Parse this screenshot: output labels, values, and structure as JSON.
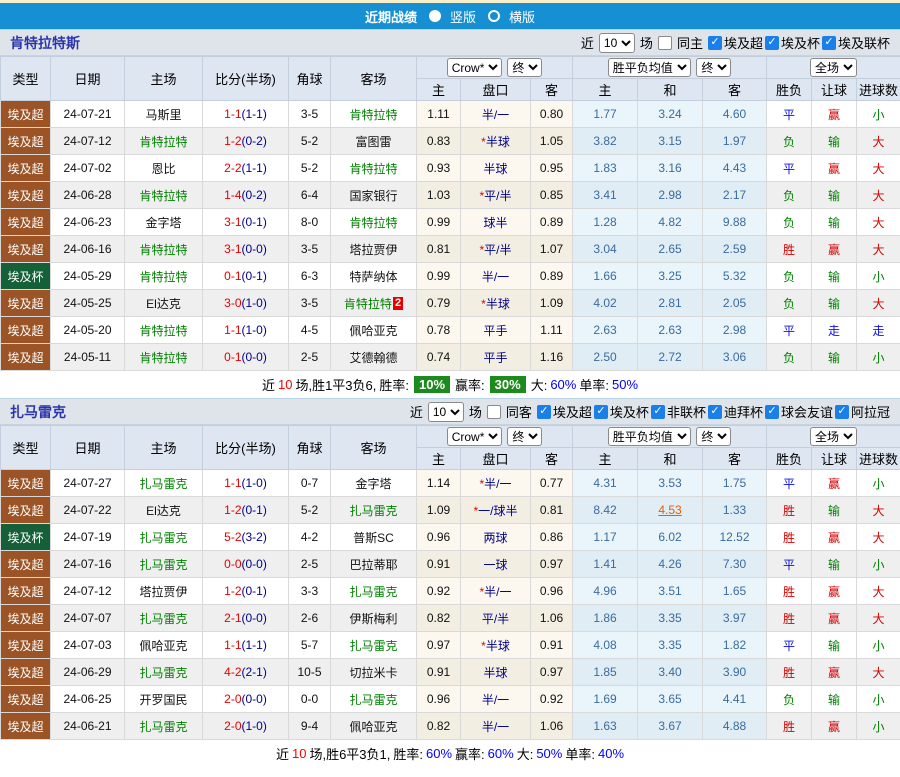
{
  "title_bar": {
    "title": "近期战绩",
    "options": [
      {
        "label": "竖版",
        "selected": true
      },
      {
        "label": "横版",
        "selected": false
      }
    ]
  },
  "columns": {
    "type": "类型",
    "date": "日期",
    "home": "主场",
    "score": "比分(半场)",
    "corner": "角球",
    "away": "客场",
    "odds_home": "主",
    "handicap": "盘口",
    "odds_away": "客",
    "avg_home": "主",
    "avg_draw": "和",
    "avg_away": "客",
    "result_wdl": "胜负",
    "result_handicap": "让球",
    "result_goals": "进球数"
  },
  "dropdowns": {
    "company": "Crow*",
    "final": "终",
    "avg": "胜平负均值",
    "scope": "全场"
  },
  "sections": [
    {
      "team": "肯特拉特斯",
      "filter": {
        "near_label": "近",
        "match_count": "10",
        "matches_label": "场",
        "same_venue_label": "同主",
        "same_venue_checked": false,
        "leagues": [
          {
            "label": "埃及超",
            "checked": true
          },
          {
            "label": "埃及杯",
            "checked": true
          },
          {
            "label": "埃及联杯",
            "checked": true
          }
        ]
      },
      "rows": [
        {
          "league": "埃及超",
          "league_type": "super",
          "date": "24-07-21",
          "home": "马斯里",
          "home_subject": false,
          "score": "1-1",
          "half": "(1-1)",
          "corner": "3-5",
          "away": "肯特拉特",
          "away_subject": true,
          "away_badge": "",
          "odds_home": "1.11",
          "handicap_star": false,
          "handicap": "半/一",
          "odds_away": "0.80",
          "avg_home": "1.77",
          "avg_draw": "3.24",
          "avg_away": "4.60",
          "avg_draw_link": false,
          "wdl": "平",
          "handicap_result": "赢",
          "goals": "小"
        },
        {
          "league": "埃及超",
          "league_type": "super",
          "date": "24-07-12",
          "home": "肯特拉特",
          "home_subject": true,
          "score": "1-2",
          "half": "(0-2)",
          "corner": "5-2",
          "away": "富图雷",
          "away_subject": false,
          "away_badge": "",
          "odds_home": "0.83",
          "handicap_star": true,
          "handicap": "半球",
          "odds_away": "1.05",
          "avg_home": "3.82",
          "avg_draw": "3.15",
          "avg_away": "1.97",
          "avg_draw_link": false,
          "wdl": "负",
          "handicap_result": "输",
          "goals": "大"
        },
        {
          "league": "埃及超",
          "league_type": "super",
          "date": "24-07-02",
          "home": "恩比",
          "home_subject": false,
          "score": "2-2",
          "half": "(1-1)",
          "corner": "5-2",
          "away": "肯特拉特",
          "away_subject": true,
          "away_badge": "",
          "odds_home": "0.93",
          "handicap_star": false,
          "handicap": "半球",
          "odds_away": "0.95",
          "avg_home": "1.83",
          "avg_draw": "3.16",
          "avg_away": "4.43",
          "avg_draw_link": false,
          "wdl": "平",
          "handicap_result": "赢",
          "goals": "大"
        },
        {
          "league": "埃及超",
          "league_type": "super",
          "date": "24-06-28",
          "home": "肯特拉特",
          "home_subject": true,
          "score": "1-4",
          "half": "(0-2)",
          "corner": "6-4",
          "away": "国家银行",
          "away_subject": false,
          "away_badge": "",
          "odds_home": "1.03",
          "handicap_star": true,
          "handicap": "平/半",
          "odds_away": "0.85",
          "avg_home": "3.41",
          "avg_draw": "2.98",
          "avg_away": "2.17",
          "avg_draw_link": false,
          "wdl": "负",
          "handicap_result": "输",
          "goals": "大"
        },
        {
          "league": "埃及超",
          "league_type": "super",
          "date": "24-06-23",
          "home": "金字塔",
          "home_subject": false,
          "score": "3-1",
          "half": "(0-1)",
          "corner": "8-0",
          "away": "肯特拉特",
          "away_subject": true,
          "away_badge": "",
          "odds_home": "0.99",
          "handicap_star": false,
          "handicap": "球半",
          "odds_away": "0.89",
          "avg_home": "1.28",
          "avg_draw": "4.82",
          "avg_away": "9.88",
          "avg_draw_link": false,
          "wdl": "负",
          "handicap_result": "输",
          "goals": "大"
        },
        {
          "league": "埃及超",
          "league_type": "super",
          "date": "24-06-16",
          "home": "肯特拉特",
          "home_subject": true,
          "score": "3-1",
          "half": "(0-0)",
          "corner": "3-5",
          "away": "塔拉贾伊",
          "away_subject": false,
          "away_badge": "",
          "odds_home": "0.81",
          "handicap_star": true,
          "handicap": "平/半",
          "odds_away": "1.07",
          "avg_home": "3.04",
          "avg_draw": "2.65",
          "avg_away": "2.59",
          "avg_draw_link": false,
          "wdl": "胜",
          "handicap_result": "赢",
          "goals": "大"
        },
        {
          "league": "埃及杯",
          "league_type": "cup",
          "date": "24-05-29",
          "home": "肯特拉特",
          "home_subject": true,
          "score": "0-1",
          "half": "(0-1)",
          "corner": "6-3",
          "away": "特萨纳体",
          "away_subject": false,
          "away_badge": "",
          "odds_home": "0.99",
          "handicap_star": false,
          "handicap": "半/一",
          "odds_away": "0.89",
          "avg_home": "1.66",
          "avg_draw": "3.25",
          "avg_away": "5.32",
          "avg_draw_link": false,
          "wdl": "负",
          "handicap_result": "输",
          "goals": "小"
        },
        {
          "league": "埃及超",
          "league_type": "super",
          "date": "24-05-25",
          "home": "El达克",
          "home_subject": false,
          "score": "3-0",
          "half": "(1-0)",
          "corner": "3-5",
          "away": "肯特拉特",
          "away_subject": true,
          "away_badge": "2",
          "odds_home": "0.79",
          "handicap_star": true,
          "handicap": "半球",
          "odds_away": "1.09",
          "avg_home": "4.02",
          "avg_draw": "2.81",
          "avg_away": "2.05",
          "avg_draw_link": false,
          "wdl": "负",
          "handicap_result": "输",
          "goals": "大"
        },
        {
          "league": "埃及超",
          "league_type": "super",
          "date": "24-05-20",
          "home": "肯特拉特",
          "home_subject": true,
          "score": "1-1",
          "half": "(1-0)",
          "corner": "4-5",
          "away": "佩哈亚克",
          "away_subject": false,
          "away_badge": "",
          "odds_home": "0.78",
          "handicap_star": false,
          "handicap": "平手",
          "odds_away": "1.11",
          "avg_home": "2.63",
          "avg_draw": "2.63",
          "avg_away": "2.98",
          "avg_draw_link": false,
          "wdl": "平",
          "handicap_result": "走",
          "goals": "走"
        },
        {
          "league": "埃及超",
          "league_type": "super",
          "date": "24-05-11",
          "home": "肯特拉特",
          "home_subject": true,
          "score": "0-1",
          "half": "(0-0)",
          "corner": "2-5",
          "away": "艾德翰德",
          "away_subject": false,
          "away_badge": "",
          "odds_home": "0.74",
          "handicap_star": false,
          "handicap": "平手",
          "odds_away": "1.16",
          "avg_home": "2.50",
          "avg_draw": "2.72",
          "avg_away": "3.06",
          "avg_draw_link": false,
          "wdl": "负",
          "handicap_result": "输",
          "goals": "小"
        }
      ],
      "summary": {
        "near": "近",
        "games": "10",
        "record": "场,胜1平3负6,",
        "win_label": "胜率:",
        "win_value": "10%",
        "cover_label": "赢率:",
        "cover_value": "30%",
        "ou_label": "大:",
        "ou_value": "60%",
        "single_label": "单率:",
        "single_value": "50%"
      }
    },
    {
      "team": "扎马雷克",
      "filter": {
        "near_label": "近",
        "match_count": "10",
        "matches_label": "场",
        "same_venue_label": "同客",
        "same_venue_checked": false,
        "leagues": [
          {
            "label": "埃及超",
            "checked": true
          },
          {
            "label": "埃及杯",
            "checked": true
          },
          {
            "label": "非联杯",
            "checked": true
          },
          {
            "label": "迪拜杯",
            "checked": true
          },
          {
            "label": "球会友谊",
            "checked": true
          },
          {
            "label": "阿拉冠",
            "checked": true
          }
        ]
      },
      "rows": [
        {
          "league": "埃及超",
          "league_type": "super",
          "date": "24-07-27",
          "home": "扎马雷克",
          "home_subject": true,
          "score": "1-1",
          "half": "(1-0)",
          "corner": "0-7",
          "away": "金字塔",
          "away_subject": false,
          "away_badge": "",
          "odds_home": "1.14",
          "handicap_star": true,
          "handicap": "半/一",
          "odds_away": "0.77",
          "avg_home": "4.31",
          "avg_draw": "3.53",
          "avg_away": "1.75",
          "avg_draw_link": false,
          "wdl": "平",
          "handicap_result": "赢",
          "goals": "小"
        },
        {
          "league": "埃及超",
          "league_type": "super",
          "date": "24-07-22",
          "home": "El达克",
          "home_subject": false,
          "score": "1-2",
          "half": "(0-1)",
          "corner": "5-2",
          "away": "扎马雷克",
          "away_subject": true,
          "away_badge": "",
          "odds_home": "1.09",
          "handicap_star": true,
          "handicap": "一/球半",
          "odds_away": "0.81",
          "avg_home": "8.42",
          "avg_draw": "4.53",
          "avg_away": "1.33",
          "avg_draw_link": true,
          "wdl": "胜",
          "handicap_result": "输",
          "goals": "大"
        },
        {
          "league": "埃及杯",
          "league_type": "cup",
          "date": "24-07-19",
          "home": "扎马雷克",
          "home_subject": true,
          "score": "5-2",
          "half": "(3-2)",
          "corner": "4-2",
          "away": "普斯SC",
          "away_subject": false,
          "away_badge": "",
          "odds_home": "0.96",
          "handicap_star": false,
          "handicap": "两球",
          "odds_away": "0.86",
          "avg_home": "1.17",
          "avg_draw": "6.02",
          "avg_away": "12.52",
          "avg_draw_link": false,
          "wdl": "胜",
          "handicap_result": "赢",
          "goals": "大"
        },
        {
          "league": "埃及超",
          "league_type": "super",
          "date": "24-07-16",
          "home": "扎马雷克",
          "home_subject": true,
          "score": "0-0",
          "half": "(0-0)",
          "corner": "2-5",
          "away": "巴拉蒂耶",
          "away_subject": false,
          "away_badge": "",
          "odds_home": "0.91",
          "handicap_star": false,
          "handicap": "一球",
          "odds_away": "0.97",
          "avg_home": "1.41",
          "avg_draw": "4.26",
          "avg_away": "7.30",
          "avg_draw_link": false,
          "wdl": "平",
          "handicap_result": "输",
          "goals": "小"
        },
        {
          "league": "埃及超",
          "league_type": "super",
          "date": "24-07-12",
          "home": "塔拉贾伊",
          "home_subject": false,
          "score": "1-2",
          "half": "(0-1)",
          "corner": "3-3",
          "away": "扎马雷克",
          "away_subject": true,
          "away_badge": "",
          "odds_home": "0.92",
          "handicap_star": true,
          "handicap": "半/一",
          "odds_away": "0.96",
          "avg_home": "4.96",
          "avg_draw": "3.51",
          "avg_away": "1.65",
          "avg_draw_link": false,
          "wdl": "胜",
          "handicap_result": "赢",
          "goals": "大"
        },
        {
          "league": "埃及超",
          "league_type": "super",
          "date": "24-07-07",
          "home": "扎马雷克",
          "home_subject": true,
          "score": "2-1",
          "half": "(0-0)",
          "corner": "2-6",
          "away": "伊斯梅利",
          "away_subject": false,
          "away_badge": "",
          "odds_home": "0.82",
          "handicap_star": false,
          "handicap": "平/半",
          "odds_away": "1.06",
          "avg_home": "1.86",
          "avg_draw": "3.35",
          "avg_away": "3.97",
          "avg_draw_link": false,
          "wdl": "胜",
          "handicap_result": "赢",
          "goals": "大"
        },
        {
          "league": "埃及超",
          "league_type": "super",
          "date": "24-07-03",
          "home": "佩哈亚克",
          "home_subject": false,
          "score": "1-1",
          "half": "(1-1)",
          "corner": "5-7",
          "away": "扎马雷克",
          "away_subject": true,
          "away_badge": "",
          "odds_home": "0.97",
          "handicap_star": true,
          "handicap": "半球",
          "odds_away": "0.91",
          "avg_home": "4.08",
          "avg_draw": "3.35",
          "avg_away": "1.82",
          "avg_draw_link": false,
          "wdl": "平",
          "handicap_result": "输",
          "goals": "小"
        },
        {
          "league": "埃及超",
          "league_type": "super",
          "date": "24-06-29",
          "home": "扎马雷克",
          "home_subject": true,
          "score": "4-2",
          "half": "(2-1)",
          "corner": "10-5",
          "away": "切拉米卡",
          "away_subject": false,
          "away_badge": "",
          "odds_home": "0.91",
          "handicap_star": false,
          "handicap": "半球",
          "odds_away": "0.97",
          "avg_home": "1.85",
          "avg_draw": "3.40",
          "avg_away": "3.90",
          "avg_draw_link": false,
          "wdl": "胜",
          "handicap_result": "赢",
          "goals": "大"
        },
        {
          "league": "埃及超",
          "league_type": "super",
          "date": "24-06-25",
          "home": "开罗国民",
          "home_subject": false,
          "score": "2-0",
          "half": "(0-0)",
          "corner": "0-0",
          "away": "扎马雷克",
          "away_subject": true,
          "away_badge": "",
          "odds_home": "0.96",
          "handicap_star": false,
          "handicap": "半/一",
          "odds_away": "0.92",
          "avg_home": "1.69",
          "avg_draw": "3.65",
          "avg_away": "4.41",
          "avg_draw_link": false,
          "wdl": "负",
          "handicap_result": "输",
          "goals": "小"
        },
        {
          "league": "埃及超",
          "league_type": "super",
          "date": "24-06-21",
          "home": "扎马雷克",
          "home_subject": true,
          "score": "2-0",
          "half": "(1-0)",
          "corner": "9-4",
          "away": "佩哈亚克",
          "away_subject": false,
          "away_badge": "",
          "odds_home": "0.82",
          "handicap_star": false,
          "handicap": "半/一",
          "odds_away": "1.06",
          "avg_home": "1.63",
          "avg_draw": "3.67",
          "avg_away": "4.88",
          "avg_draw_link": false,
          "wdl": "胜",
          "handicap_result": "赢",
          "goals": "小"
        }
      ],
      "summary": {
        "near": "近",
        "games": "10",
        "record": "场,胜6平3负1,",
        "win_label": "胜率:",
        "win_value": "60%",
        "cover_label": "赢率:",
        "cover_value": "60%",
        "ou_label": "大:",
        "ou_value": "50%",
        "single_label": "单率:",
        "single_value": "40%"
      }
    }
  ]
}
